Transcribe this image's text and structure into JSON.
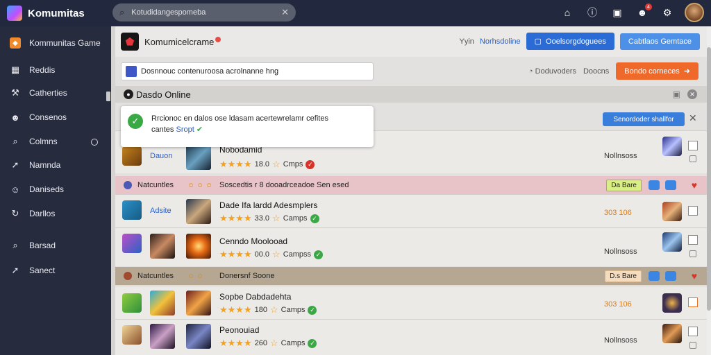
{
  "app": {
    "name": "Komumitas"
  },
  "search": {
    "value": "Kotudidangespomeba"
  },
  "topbar": {
    "icons": [
      "home-icon",
      "info-icon",
      "image-icon",
      "notification-icon",
      "settings-icon"
    ],
    "notification_count": "4"
  },
  "sidebar": {
    "items": [
      {
        "label": "Kommunitas Game",
        "icon": "game-icon"
      },
      {
        "label": "Reddis",
        "icon": "grid-icon"
      },
      {
        "label": "Catherties",
        "icon": "wrench-icon"
      },
      {
        "label": "Consenos",
        "icon": "users-icon"
      },
      {
        "label": "Colmns",
        "icon": "search-icon"
      },
      {
        "label": "Namnda",
        "icon": "pin-icon"
      },
      {
        "label": "Daniseds",
        "icon": "people-icon"
      },
      {
        "label": "Darllos",
        "icon": "refresh-icon"
      },
      {
        "label": "Barsad",
        "icon": "search-icon"
      },
      {
        "label": "Sanect",
        "icon": "send-icon"
      }
    ]
  },
  "header": {
    "title": "Komumicelcrame",
    "link_label": "Yyin",
    "link_blue": "Norhsdoline",
    "btn_primary": "Ooelsorgdoguees",
    "btn_secondary": "Cabtlaos Gemtace"
  },
  "toolbar": {
    "input_value": "Dosnnouc contenuroosa acrolnanne hng",
    "status": "Doduvoders",
    "status2": "Doocns",
    "btn_orange": "Bondo corneces"
  },
  "section": {
    "title": "Dasdo Online"
  },
  "popup": {
    "text": "Rrcionoc en dalos ose ldasam acertewrelamr cefites",
    "link_prefix": "cantes",
    "link": "Sropt",
    "sticky_btn": "Senordoder shallfor"
  },
  "rows": [
    {
      "left_label": "Dauon",
      "title": "Nobodamid",
      "rating": "18.0",
      "count": "Cmps",
      "verified": "red",
      "status": "Nollnsoss",
      "status_color": "gray"
    },
    {
      "left_label": "Adsite",
      "title": "Dade Ifa lardd Adesmplers",
      "rating": "33.0",
      "count": "Camps",
      "verified": "green",
      "status": "303 106",
      "status_color": "orange"
    },
    {
      "left_label": "",
      "title": "Cenndo Moolooad",
      "rating": "00.0",
      "count": "Campss",
      "verified": "green",
      "status": "Nollnsoss",
      "status_color": "gray"
    },
    {
      "left_label": "",
      "title": "Sopbe Dabdadehta",
      "rating": "180",
      "count": "Camps",
      "verified": "green",
      "status": "303 106",
      "status_color": "orange"
    },
    {
      "left_label": "",
      "title": "Peonouiad",
      "rating": "260",
      "count": "Camps",
      "verified": "green",
      "status": "Nollnsoss",
      "status_color": "gray"
    }
  ],
  "subheaders": [
    {
      "label": "Natcuntles",
      "emoji": "☺ ☺ ☺",
      "text": "Soscedtis r 8 dooadrceadoe Sen esed",
      "pill": "Da Bare",
      "pill_color": "#d9ee86"
    },
    {
      "label": "Natcuntles",
      "emoji": "☺ ☺",
      "text": "Donersnf Soone",
      "pill": "D.s Bare",
      "pill_color": "#f6dcbf"
    }
  ],
  "colors": {
    "accent": "#2a6bd6",
    "orange": "#ef6a2a",
    "sidebar": "#262b3e",
    "topbar": "#22283d",
    "star": "#f2a21f"
  }
}
